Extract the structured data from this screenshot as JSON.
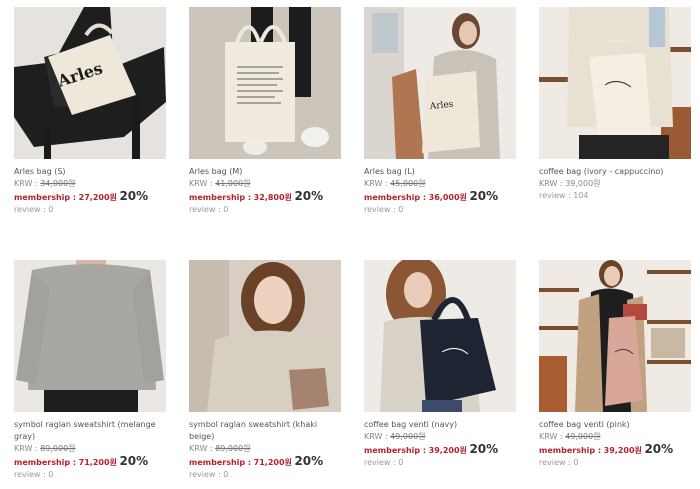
{
  "products": [
    {
      "name": "Arles bag (S)",
      "krw_label": "KRW :",
      "original": "34,000원",
      "membership_label": "membership :",
      "member_price": "27,200원",
      "discount": "20%",
      "review": "review : 0"
    },
    {
      "name": "Arles bag (M)",
      "krw_label": "KRW :",
      "original": "41,000원",
      "membership_label": "membership :",
      "member_price": "32,800원",
      "discount": "20%",
      "review": "review : 0"
    },
    {
      "name": "Arles bag (L)",
      "krw_label": "KRW :",
      "original": "45,000원",
      "membership_label": "membership :",
      "member_price": "36,000원",
      "discount": "20%",
      "review": "review : 0"
    },
    {
      "name": "coffee bag (ivory - cappuccino)",
      "krw_label": "KRW :",
      "price": "39,000원",
      "review": "review : 104"
    },
    {
      "name": "symbol raglan sweatshirt (melange gray)",
      "krw_label": "KRW :",
      "original": "89,000원",
      "membership_label": "membership :",
      "member_price": "71,200원",
      "discount": "20%",
      "review": "review : 0"
    },
    {
      "name": "symbol raglan sweatshirt (khaki beige)",
      "krw_label": "KRW :",
      "original": "89,000원",
      "membership_label": "membership :",
      "member_price": "71,200원",
      "discount": "20%",
      "review": "review : 0"
    },
    {
      "name": "coffee bag venti (navy)",
      "krw_label": "KRW :",
      "original": "49,000원",
      "membership_label": "membership :",
      "member_price": "39,200원",
      "discount": "20%",
      "review": "review : 0"
    },
    {
      "name": "coffee bag venti (pink)",
      "krw_label": "KRW :",
      "original": "49,000원",
      "membership_label": "membership :",
      "member_price": "39,200원",
      "discount": "20%",
      "review": "review : 0"
    }
  ],
  "image_text": {
    "arles_s": "Arles",
    "arles_m": "",
    "arles_l": "Arles",
    "coffee_ivory": ""
  },
  "colors": {
    "membership_red": "#b3232f",
    "navy_bag": "#1f2433",
    "pink_bag": "#d9a69a"
  }
}
